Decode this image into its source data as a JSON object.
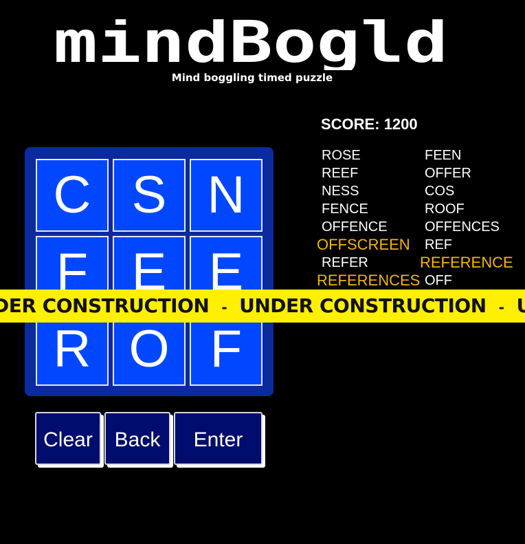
{
  "header": {
    "logo_text": "mindBogld",
    "subtitle": "Mind boggling timed puzzle"
  },
  "score": {
    "label": "SCORE:",
    "value": "1200"
  },
  "board": {
    "tiles": [
      "C",
      "S",
      "N",
      "F",
      "E",
      "E",
      "R",
      "O",
      "F"
    ]
  },
  "found_words": [
    {
      "word": "ROSE",
      "highlight": false
    },
    {
      "word": "FEEN",
      "highlight": false
    },
    {
      "word": "REEF",
      "highlight": false
    },
    {
      "word": "OFFER",
      "highlight": false
    },
    {
      "word": "NESS",
      "highlight": false
    },
    {
      "word": "COS",
      "highlight": false
    },
    {
      "word": "FENCE",
      "highlight": false
    },
    {
      "word": "ROOF",
      "highlight": false
    },
    {
      "word": "OFFENCE",
      "highlight": false
    },
    {
      "word": "OFFENCES",
      "highlight": false
    },
    {
      "word": "OFFSCREEN",
      "highlight": true
    },
    {
      "word": "REF",
      "highlight": false
    },
    {
      "word": "REFER",
      "highlight": false
    },
    {
      "word": "REFERENCE",
      "highlight": true
    },
    {
      "word": "REFERENCES",
      "highlight": true
    },
    {
      "word": "OFF",
      "highlight": false
    }
  ],
  "banner": {
    "text": "UNDER CONSTRUCTION",
    "separator": "-",
    "text_visible_start": "DER CONSTRUCTION",
    "text_visible_end": "UND"
  },
  "controls": {
    "clear_label": "Clear",
    "back_label": "Back",
    "enter_label": "Enter"
  },
  "colors": {
    "background": "#000000",
    "board": "#0a2a9f",
    "tile": "#0047ff",
    "highlight_word": "#f5b50a",
    "tape": "#ffef00",
    "button": "#000c6e"
  }
}
